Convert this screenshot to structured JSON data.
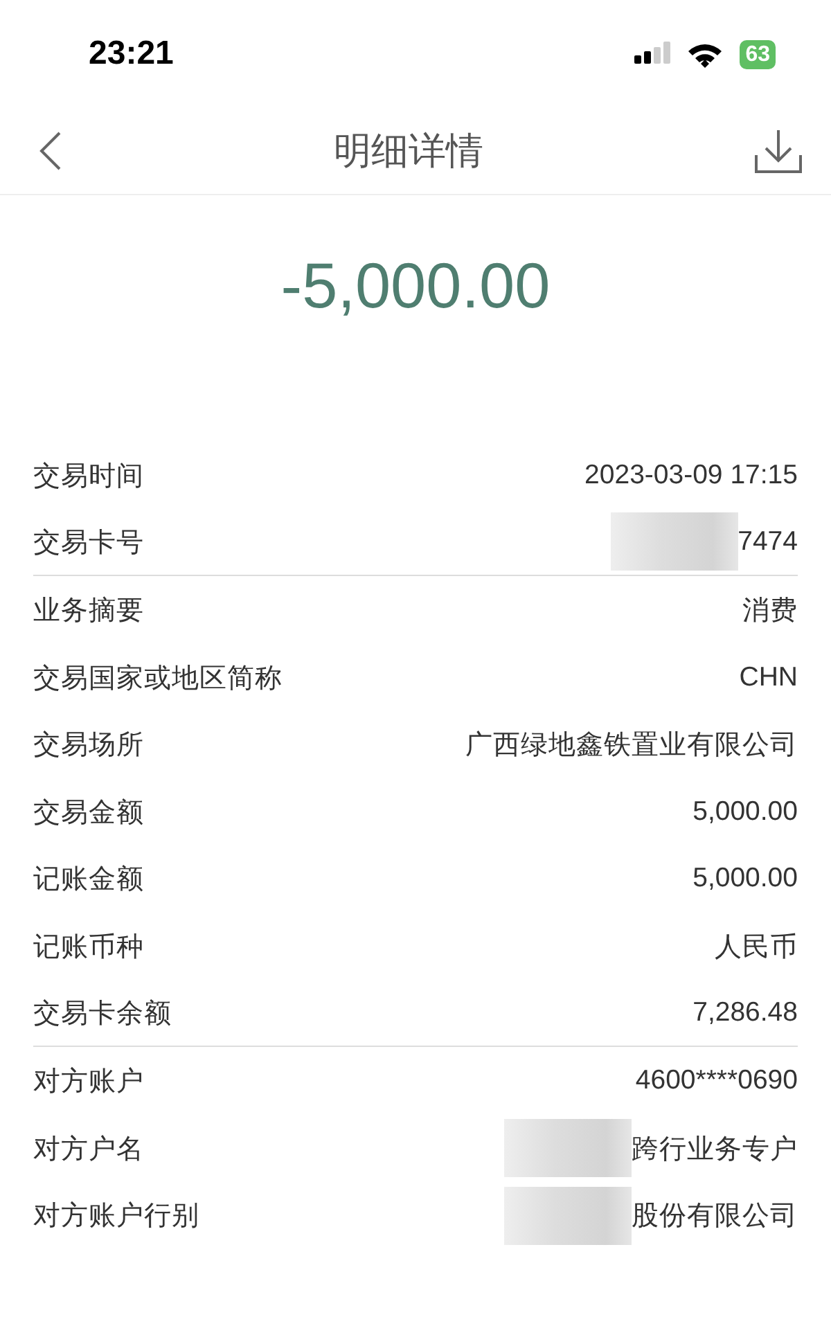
{
  "status_bar": {
    "time": "23:21",
    "battery": "63"
  },
  "header": {
    "title": "明细详情"
  },
  "amount": "-5,000.00",
  "rows": [
    {
      "label": "交易时间",
      "value": "2023-03-09 17:15",
      "masked": false,
      "divider": false
    },
    {
      "label": "交易卡号",
      "value": "7474",
      "masked": true,
      "divider": true
    },
    {
      "label": "业务摘要",
      "value": "消费",
      "masked": false,
      "divider": false
    },
    {
      "label": "交易国家或地区简称",
      "value": "CHN",
      "masked": false,
      "divider": false
    },
    {
      "label": "交易场所",
      "value": "广西绿地鑫铁置业有限公司",
      "masked": false,
      "divider": false
    },
    {
      "label": "交易金额",
      "value": "5,000.00",
      "masked": false,
      "divider": false
    },
    {
      "label": "记账金额",
      "value": "5,000.00",
      "masked": false,
      "divider": false
    },
    {
      "label": "记账币种",
      "value": "人民币",
      "masked": false,
      "divider": false
    },
    {
      "label": "交易卡余额",
      "value": "7,286.48",
      "masked": false,
      "divider": true
    },
    {
      "label": "对方账户",
      "value": "4600****0690",
      "masked": false,
      "divider": false
    },
    {
      "label": "对方户名",
      "value": "跨行业务专户",
      "masked": true,
      "divider": false
    },
    {
      "label": "对方账户行别",
      "value": "股份有限公司",
      "masked": true,
      "divider": false
    }
  ]
}
